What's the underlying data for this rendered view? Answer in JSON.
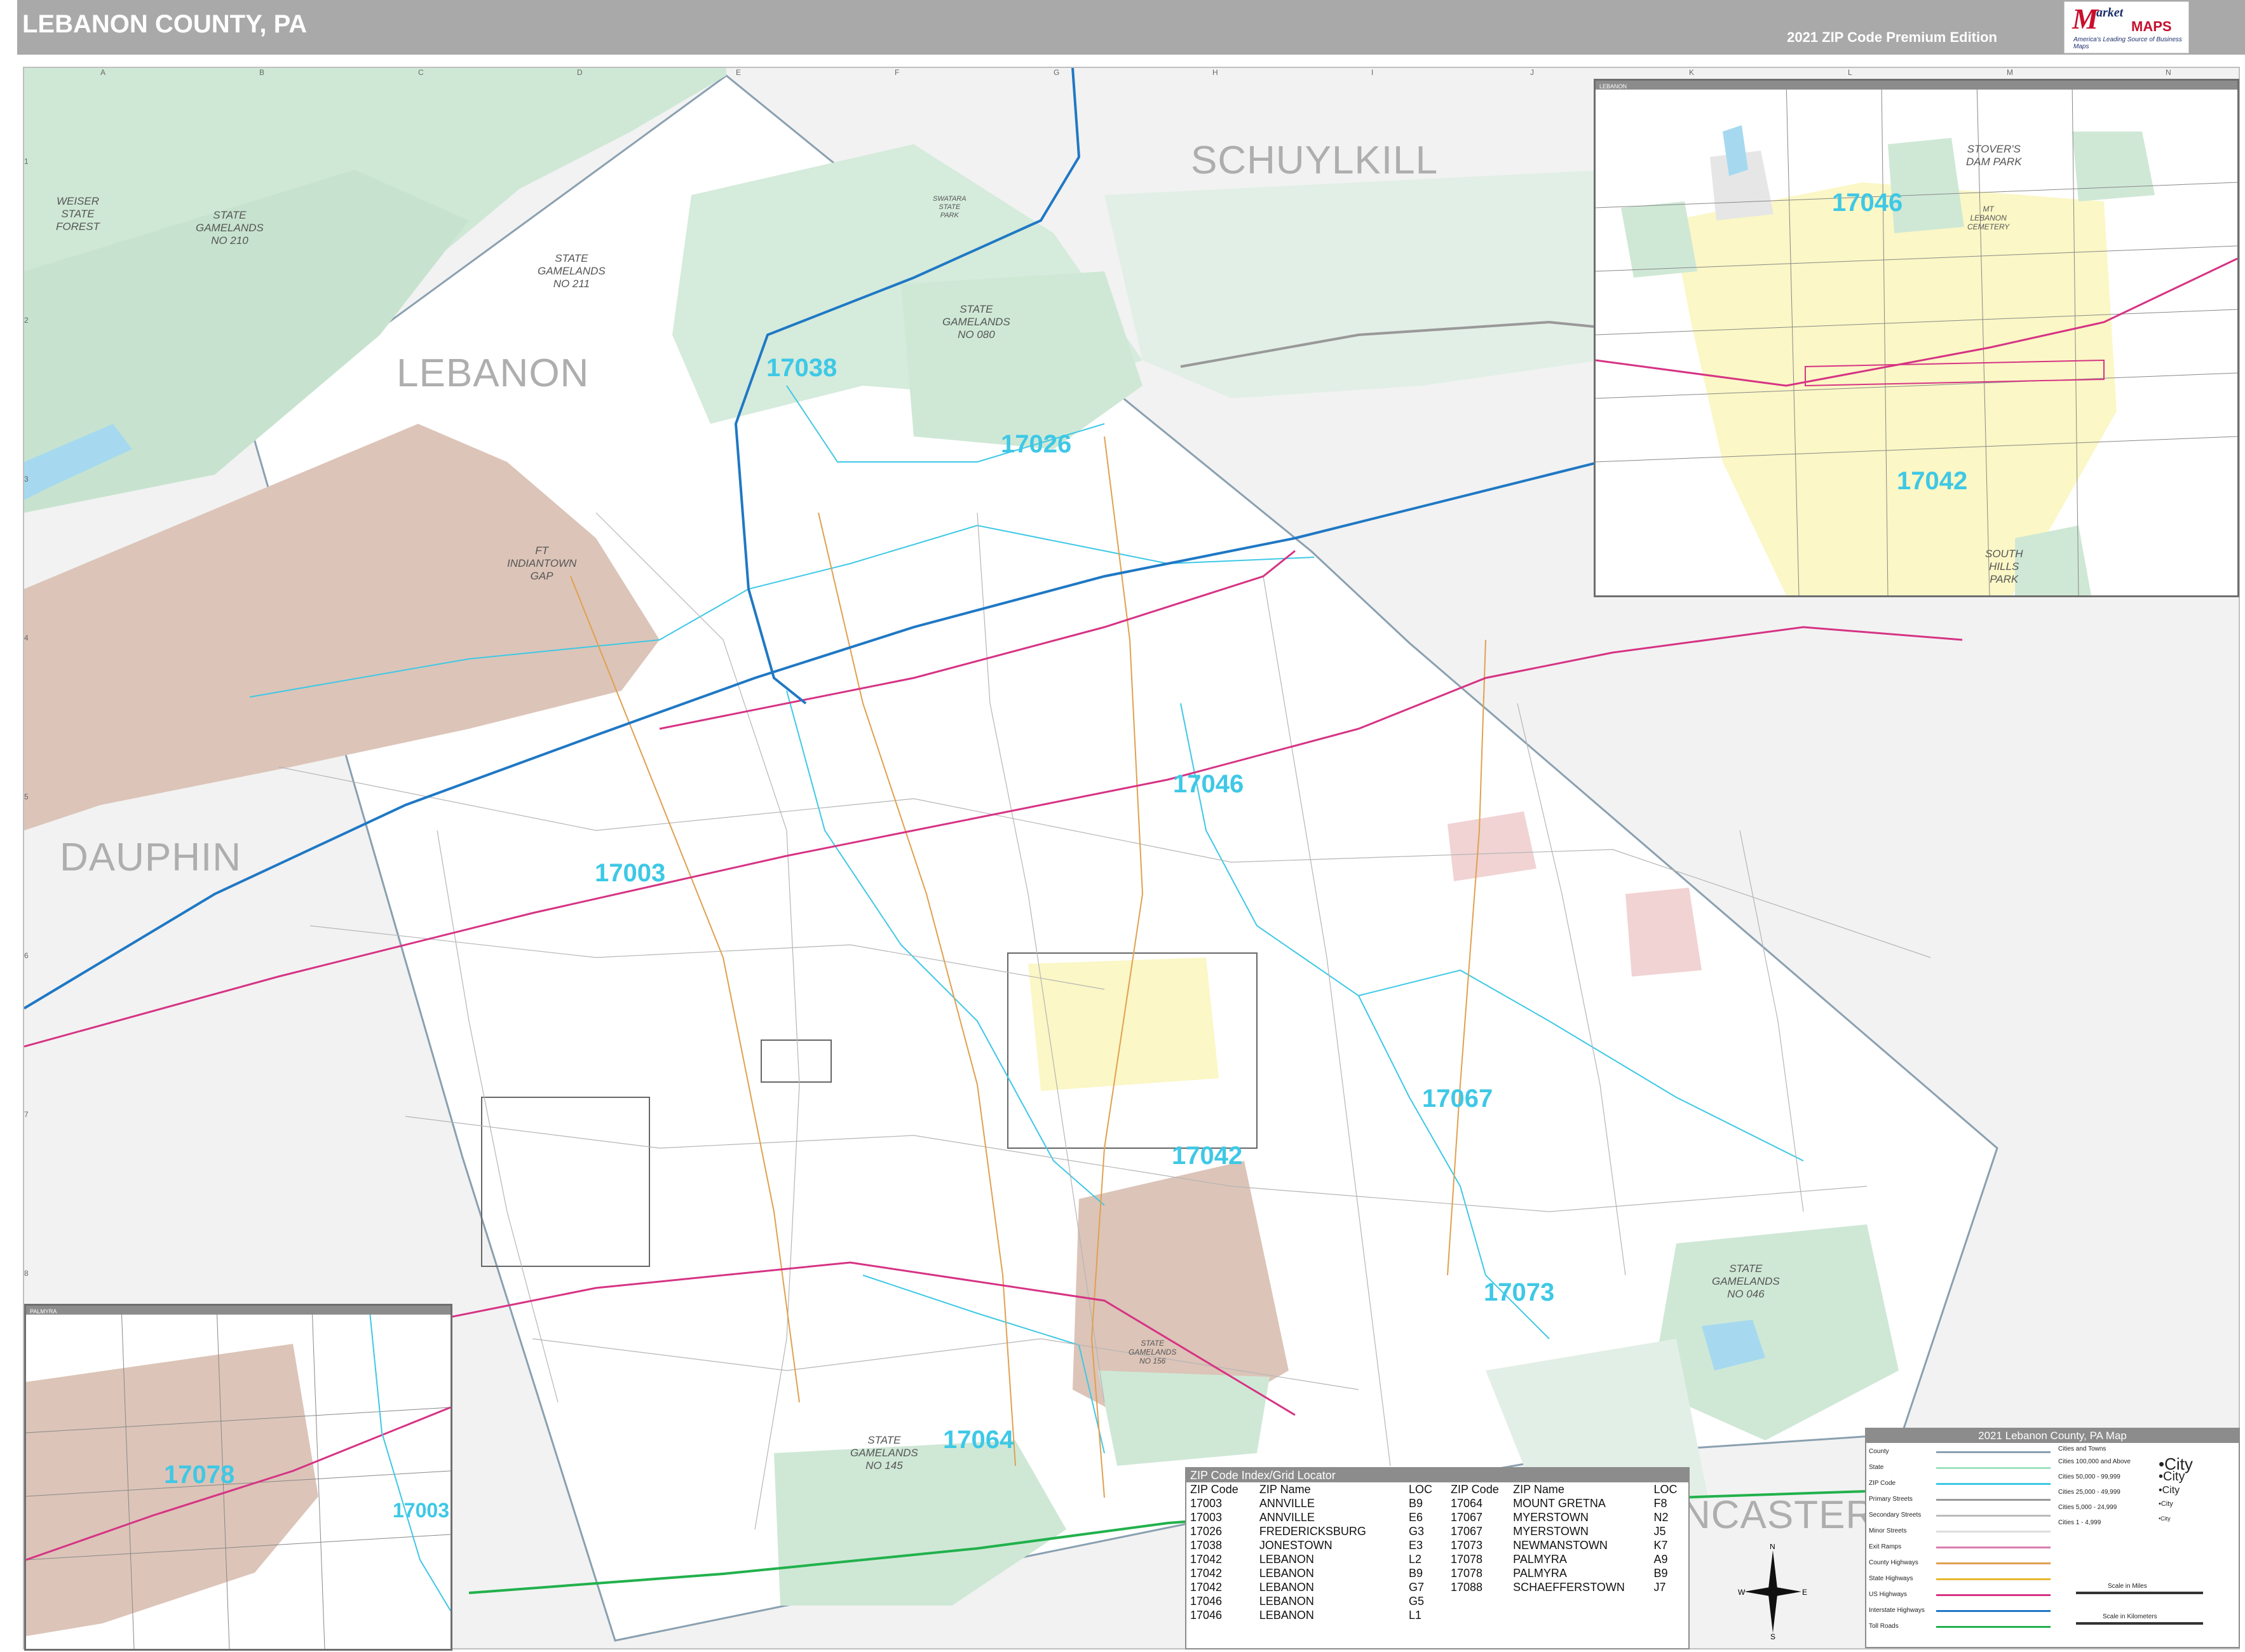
{
  "header": {
    "title": "LEBANON COUNTY, PA",
    "edition": "2021 ZIP Code Premium Edition",
    "logo": {
      "m": "M",
      "arket": "arket",
      "maps": "MAPS",
      "tagline": "America's Leading Source of Business Maps"
    }
  },
  "grid": {
    "columns": [
      "A",
      "B",
      "C",
      "D",
      "E",
      "F",
      "G",
      "H",
      "I",
      "J",
      "K",
      "L",
      "M",
      "N"
    ],
    "rows": [
      "1",
      "2",
      "3",
      "4",
      "5",
      "6",
      "7",
      "8",
      "9"
    ]
  },
  "counties": {
    "schuylkill": "SCHUYLKILL",
    "lebanon": "LEBANON",
    "dauphin": "DAUPHIN",
    "lancaster": "NCASTER"
  },
  "zip_labels": {
    "z17038": "17038",
    "z17026": "17026",
    "z17046": "17046",
    "z17003": "17003",
    "z17067": "17067",
    "z17042": "17042",
    "z17073": "17073",
    "z17064": "17064",
    "inset_17046": "17046",
    "inset_17042": "17042",
    "inset_17078": "17078",
    "inset_17003": "17003"
  },
  "land_labels": {
    "weiser": "WEISER\nSTATE\nFOREST",
    "sgl210": "STATE\nGAMELANDS\nNO 210",
    "sgl211": "STATE\nGAMELANDS\nNO 211",
    "sgl080": "STATE\nGAMELANDS\nNO 080",
    "swatara": "SWATARA\nSTATE\nPARK",
    "ftig": "FT\nINDIANTOWN\nGAP",
    "sgl156": "STATE\nGAMELANDS\nNO 156",
    "sgl145": "STATE\nGAMELANDS\nNO 145",
    "sgl046": "STATE\nGAMELANDS\nNO 046",
    "stovers": "STOVER'S\nDAM PARK",
    "southhills": "SOUTH\nHILLS\nPARK",
    "mtlebanon": "MT\nLEBANON\nCEMETERY"
  },
  "insets": {
    "lebanon": "LEBANON",
    "palmyra": "PALMYRA"
  },
  "zip_index": {
    "title": "ZIP Code Index/Grid Locator",
    "headers": [
      "ZIP Code",
      "ZIP Name",
      "LOC"
    ],
    "left": [
      [
        "17003",
        "ANNVILLE",
        "B9"
      ],
      [
        "17003",
        "ANNVILLE",
        "E6"
      ],
      [
        "17026",
        "FREDERICKSBURG",
        "G3"
      ],
      [
        "17038",
        "JONESTOWN",
        "E3"
      ],
      [
        "17042",
        "LEBANON",
        "L2"
      ],
      [
        "17042",
        "LEBANON",
        "B9"
      ],
      [
        "17042",
        "LEBANON",
        "G7"
      ],
      [
        "17046",
        "LEBANON",
        "G5"
      ],
      [
        "17046",
        "LEBANON",
        "L1"
      ]
    ],
    "right": [
      [
        "17064",
        "MOUNT GRETNA",
        "F8"
      ],
      [
        "17067",
        "MYERSTOWN",
        "N2"
      ],
      [
        "17067",
        "MYERSTOWN",
        "J5"
      ],
      [
        "17073",
        "NEWMANSTOWN",
        "K7"
      ],
      [
        "17078",
        "PALMYRA",
        "A9"
      ],
      [
        "17078",
        "PALMYRA",
        "B9"
      ],
      [
        "17088",
        "SCHAEFFERSTOWN",
        "J7"
      ]
    ]
  },
  "legend": {
    "title": "2021 Lebanon County, PA Map",
    "items": [
      "County",
      "State",
      "ZIP Code",
      "Primary Streets",
      "Secondary Streets",
      "Minor Streets",
      "Exit Ramps",
      "County Highways",
      "State Highways",
      "US Highways",
      "Interstate Highways",
      "Toll Roads"
    ],
    "cities_title": "Cities and Towns",
    "cities": [
      {
        "range": "Cities 100,000 and Above",
        "sample": "•City"
      },
      {
        "range": "Cities 50,000 - 99,999",
        "sample": "•City"
      },
      {
        "range": "Cities 25,000 - 49,999",
        "sample": "•City"
      },
      {
        "range": "Cities 5,000 - 24,999",
        "sample": "•City"
      },
      {
        "range": "Cities 1 - 4,999",
        "sample": "•City"
      }
    ],
    "scale_miles": "Scale in Miles",
    "scale_km": "Scale in Kilometers"
  },
  "compass": {
    "n": "N",
    "s": "S",
    "e": "E",
    "w": "W"
  },
  "colors": {
    "forest": "#cfe8d6",
    "military": "#dcc4b8",
    "zip_line": "#3ec8e6",
    "interstate": "#1f78c4",
    "us_highway": "#d63384",
    "toll": "#22b14c",
    "county_border": "#8aa0b0"
  }
}
